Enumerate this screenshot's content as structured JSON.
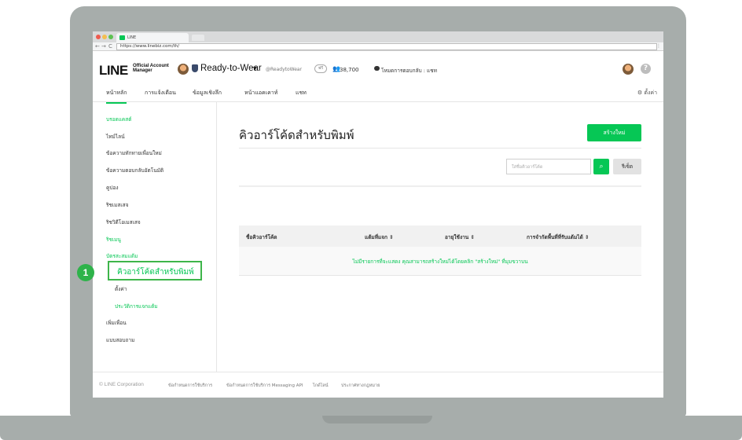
{
  "browser": {
    "tab_title": "LINE",
    "url": "https://www.linebiz.com/th/",
    "back_glyph": "←",
    "forward_glyph": "→",
    "reload_glyph": "C",
    "menu_glyph": "⋮",
    "traffic_colors": [
      "#ee5b4f",
      "#f4be4f",
      "#5dc152"
    ]
  },
  "header": {
    "logo_text": "LINE",
    "logo_sub_line1": "Official Account",
    "logo_sub_line2": "Manager",
    "account_name": "Ready-to-Wear",
    "account_caret": "▼",
    "account_id": "@ReadytoWear",
    "plan_badge": "ฟรี",
    "followers_icon": "👥",
    "followers_count": "38,700",
    "chat_mode": "โหมดการตอบกลับ : แชท",
    "help_glyph": "?"
  },
  "main_tabs": [
    {
      "label": "หน้าหลัก",
      "active": true
    },
    {
      "label": "การแจ้งเตือน",
      "active": false
    },
    {
      "label": "ข้อมูลเชิงลึก",
      "active": false
    },
    {
      "label": "หน้าแอคเคาท์",
      "active": false
    },
    {
      "label": "แชท",
      "active": false
    }
  ],
  "settings_label": "⚙ ตั้งค่า",
  "sidebar": {
    "items": [
      {
        "label": "บรอดแคสต์",
        "style": "green"
      },
      {
        "label": "ไทม์ไลน์",
        "style": "normal"
      },
      {
        "label": "ข้อความทักทายเพื่อนใหม่",
        "style": "normal"
      },
      {
        "label": "ข้อความตอบกลับอัตโนมัติ",
        "style": "normal"
      },
      {
        "label": "คูปอง",
        "style": "normal"
      },
      {
        "label": "ริชเมสเสจ",
        "style": "normal"
      },
      {
        "label": "ริชวิดีโอเมสเสจ",
        "style": "normal"
      },
      {
        "label": "ริชเมนู",
        "style": "green"
      },
      {
        "label": "บัตรสะสมแต้ม",
        "style": "green"
      }
    ],
    "highlighted": "คิวอาร์โค้ดสำหรับพิมพ์",
    "sub_items": [
      "ตั้งค่า",
      "ประวัติการแจกแต้ม"
    ],
    "bottom_items": [
      "เพิ่มเพื่อน",
      "แบบสอบถาม"
    ],
    "step_number": "1"
  },
  "content": {
    "title": "คิวอาร์โค้ดสำหรับพิมพ์",
    "create_button": "สร้างใหม่",
    "search_placeholder": "ใส่ชื่อคิวอาร์โค้ด",
    "search_glyph": "🔍",
    "reset_button": "รีเซ็ต",
    "columns": [
      "ชื่อคิวอาร์โค้ด",
      "แต้มที่แจก ⇕",
      "อายุใช้งาน ⇕",
      "การจำกัดพื้นที่ที่รับแต้มได้ ⇕"
    ],
    "empty_message": "ไม่มีรายการที่จะแสดง คุณสามารถสร้างใหม่ได้โดยคลิก \"สร้างใหม่\" ที่มุมขวาบน"
  },
  "footer": {
    "copyright": "© LINE Corporation",
    "links": [
      "ข้อกำหนดการใช้บริการ",
      "ข้อกำหนดการใช้บริการ Messaging API",
      "ไกด์ไลน์",
      "ประกาศทางกฎหมาย"
    ]
  },
  "colors": {
    "brand_green": "#06c755",
    "highlight_green": "#3eb54a",
    "laptop_gray": "#a7adab"
  }
}
